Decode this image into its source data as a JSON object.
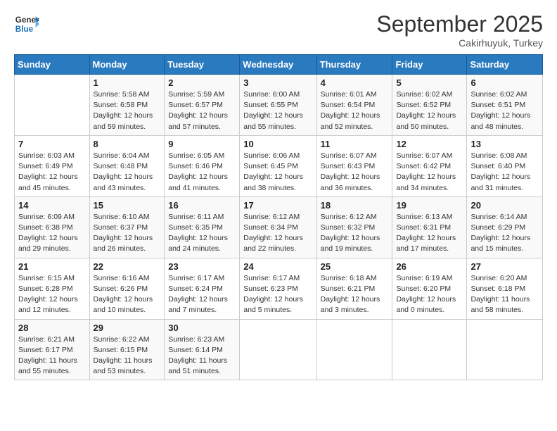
{
  "header": {
    "logo_line1": "General",
    "logo_line2": "Blue",
    "month": "September 2025",
    "location": "Cakirhuyuk, Turkey"
  },
  "days_of_week": [
    "Sunday",
    "Monday",
    "Tuesday",
    "Wednesday",
    "Thursday",
    "Friday",
    "Saturday"
  ],
  "weeks": [
    [
      {
        "day": "",
        "sunrise": "",
        "sunset": "",
        "daylight": ""
      },
      {
        "day": "1",
        "sunrise": "Sunrise: 5:58 AM",
        "sunset": "Sunset: 6:58 PM",
        "daylight": "Daylight: 12 hours and 59 minutes."
      },
      {
        "day": "2",
        "sunrise": "Sunrise: 5:59 AM",
        "sunset": "Sunset: 6:57 PM",
        "daylight": "Daylight: 12 hours and 57 minutes."
      },
      {
        "day": "3",
        "sunrise": "Sunrise: 6:00 AM",
        "sunset": "Sunset: 6:55 PM",
        "daylight": "Daylight: 12 hours and 55 minutes."
      },
      {
        "day": "4",
        "sunrise": "Sunrise: 6:01 AM",
        "sunset": "Sunset: 6:54 PM",
        "daylight": "Daylight: 12 hours and 52 minutes."
      },
      {
        "day": "5",
        "sunrise": "Sunrise: 6:02 AM",
        "sunset": "Sunset: 6:52 PM",
        "daylight": "Daylight: 12 hours and 50 minutes."
      },
      {
        "day": "6",
        "sunrise": "Sunrise: 6:02 AM",
        "sunset": "Sunset: 6:51 PM",
        "daylight": "Daylight: 12 hours and 48 minutes."
      }
    ],
    [
      {
        "day": "7",
        "sunrise": "Sunrise: 6:03 AM",
        "sunset": "Sunset: 6:49 PM",
        "daylight": "Daylight: 12 hours and 45 minutes."
      },
      {
        "day": "8",
        "sunrise": "Sunrise: 6:04 AM",
        "sunset": "Sunset: 6:48 PM",
        "daylight": "Daylight: 12 hours and 43 minutes."
      },
      {
        "day": "9",
        "sunrise": "Sunrise: 6:05 AM",
        "sunset": "Sunset: 6:46 PM",
        "daylight": "Daylight: 12 hours and 41 minutes."
      },
      {
        "day": "10",
        "sunrise": "Sunrise: 6:06 AM",
        "sunset": "Sunset: 6:45 PM",
        "daylight": "Daylight: 12 hours and 38 minutes."
      },
      {
        "day": "11",
        "sunrise": "Sunrise: 6:07 AM",
        "sunset": "Sunset: 6:43 PM",
        "daylight": "Daylight: 12 hours and 36 minutes."
      },
      {
        "day": "12",
        "sunrise": "Sunrise: 6:07 AM",
        "sunset": "Sunset: 6:42 PM",
        "daylight": "Daylight: 12 hours and 34 minutes."
      },
      {
        "day": "13",
        "sunrise": "Sunrise: 6:08 AM",
        "sunset": "Sunset: 6:40 PM",
        "daylight": "Daylight: 12 hours and 31 minutes."
      }
    ],
    [
      {
        "day": "14",
        "sunrise": "Sunrise: 6:09 AM",
        "sunset": "Sunset: 6:38 PM",
        "daylight": "Daylight: 12 hours and 29 minutes."
      },
      {
        "day": "15",
        "sunrise": "Sunrise: 6:10 AM",
        "sunset": "Sunset: 6:37 PM",
        "daylight": "Daylight: 12 hours and 26 minutes."
      },
      {
        "day": "16",
        "sunrise": "Sunrise: 6:11 AM",
        "sunset": "Sunset: 6:35 PM",
        "daylight": "Daylight: 12 hours and 24 minutes."
      },
      {
        "day": "17",
        "sunrise": "Sunrise: 6:12 AM",
        "sunset": "Sunset: 6:34 PM",
        "daylight": "Daylight: 12 hours and 22 minutes."
      },
      {
        "day": "18",
        "sunrise": "Sunrise: 6:12 AM",
        "sunset": "Sunset: 6:32 PM",
        "daylight": "Daylight: 12 hours and 19 minutes."
      },
      {
        "day": "19",
        "sunrise": "Sunrise: 6:13 AM",
        "sunset": "Sunset: 6:31 PM",
        "daylight": "Daylight: 12 hours and 17 minutes."
      },
      {
        "day": "20",
        "sunrise": "Sunrise: 6:14 AM",
        "sunset": "Sunset: 6:29 PM",
        "daylight": "Daylight: 12 hours and 15 minutes."
      }
    ],
    [
      {
        "day": "21",
        "sunrise": "Sunrise: 6:15 AM",
        "sunset": "Sunset: 6:28 PM",
        "daylight": "Daylight: 12 hours and 12 minutes."
      },
      {
        "day": "22",
        "sunrise": "Sunrise: 6:16 AM",
        "sunset": "Sunset: 6:26 PM",
        "daylight": "Daylight: 12 hours and 10 minutes."
      },
      {
        "day": "23",
        "sunrise": "Sunrise: 6:17 AM",
        "sunset": "Sunset: 6:24 PM",
        "daylight": "Daylight: 12 hours and 7 minutes."
      },
      {
        "day": "24",
        "sunrise": "Sunrise: 6:17 AM",
        "sunset": "Sunset: 6:23 PM",
        "daylight": "Daylight: 12 hours and 5 minutes."
      },
      {
        "day": "25",
        "sunrise": "Sunrise: 6:18 AM",
        "sunset": "Sunset: 6:21 PM",
        "daylight": "Daylight: 12 hours and 3 minutes."
      },
      {
        "day": "26",
        "sunrise": "Sunrise: 6:19 AM",
        "sunset": "Sunset: 6:20 PM",
        "daylight": "Daylight: 12 hours and 0 minutes."
      },
      {
        "day": "27",
        "sunrise": "Sunrise: 6:20 AM",
        "sunset": "Sunset: 6:18 PM",
        "daylight": "Daylight: 11 hours and 58 minutes."
      }
    ],
    [
      {
        "day": "28",
        "sunrise": "Sunrise: 6:21 AM",
        "sunset": "Sunset: 6:17 PM",
        "daylight": "Daylight: 11 hours and 55 minutes."
      },
      {
        "day": "29",
        "sunrise": "Sunrise: 6:22 AM",
        "sunset": "Sunset: 6:15 PM",
        "daylight": "Daylight: 11 hours and 53 minutes."
      },
      {
        "day": "30",
        "sunrise": "Sunrise: 6:23 AM",
        "sunset": "Sunset: 6:14 PM",
        "daylight": "Daylight: 11 hours and 51 minutes."
      },
      {
        "day": "",
        "sunrise": "",
        "sunset": "",
        "daylight": ""
      },
      {
        "day": "",
        "sunrise": "",
        "sunset": "",
        "daylight": ""
      },
      {
        "day": "",
        "sunrise": "",
        "sunset": "",
        "daylight": ""
      },
      {
        "day": "",
        "sunrise": "",
        "sunset": "",
        "daylight": ""
      }
    ]
  ]
}
